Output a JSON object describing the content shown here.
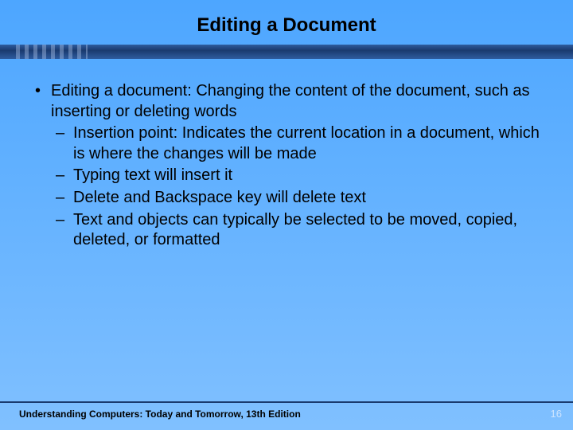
{
  "title": "Editing a Document",
  "bullet": {
    "main": "Editing a document: Changing the content of the document, such as inserting or deleting words",
    "subs": [
      "Insertion point: Indicates the current location in a document, which is where the changes will be made",
      "Typing text will insert it",
      "Delete and Backspace key will delete text",
      "Text and objects can typically be selected to be moved, copied, deleted, or formatted"
    ]
  },
  "footer": {
    "text": "Understanding Computers: Today and Tomorrow, 13th Edition",
    "page": "16"
  }
}
